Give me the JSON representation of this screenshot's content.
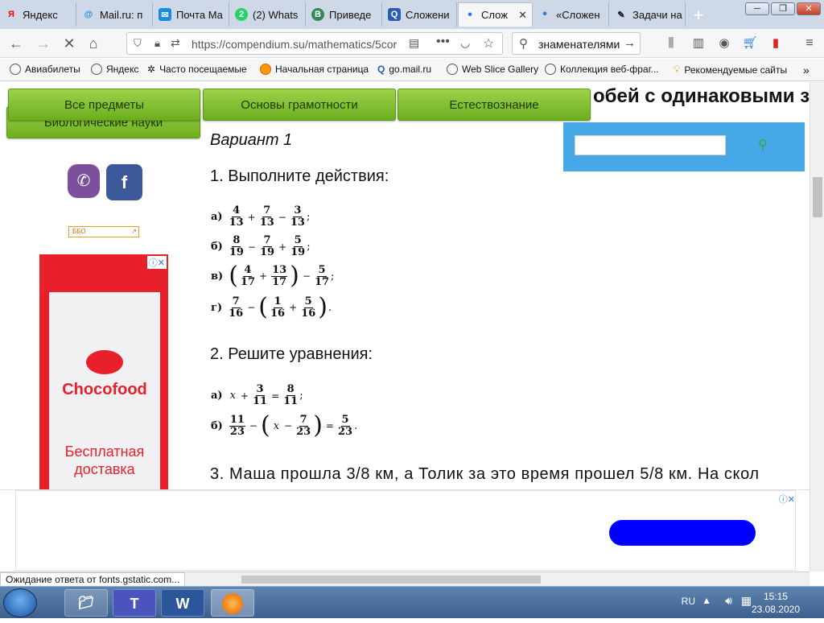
{
  "tabs": [
    {
      "label": "Яндекс",
      "icon": "Я",
      "color": "#ff0000"
    },
    {
      "label": "Mail.ru: п",
      "icon": "@",
      "color": "#168de2"
    },
    {
      "label": "Почта Ма",
      "icon": "✉",
      "color": "#168de2"
    },
    {
      "label": "(2) Whats",
      "icon": "2",
      "color": "#25d366"
    },
    {
      "label": "Приведе",
      "icon": "В",
      "color": "#2e8b57"
    },
    {
      "label": "Сложени",
      "icon": "Q",
      "color": "#2a5db0"
    },
    {
      "label": "Слож",
      "icon": "•",
      "color": "#2a7ae2"
    },
    {
      "label": "«Сложен",
      "icon": "•",
      "color": "#2a7ae2"
    },
    {
      "label": "Задачи на",
      "icon": "✎",
      "color": "#333333"
    }
  ],
  "nav": {
    "url": "https://compendium.su/mathematics/5cor",
    "search": "знаменателями"
  },
  "bookmarks": [
    "Авиабилеты",
    "Яндекс",
    "Часто посещаемые",
    "Начальная страница",
    "go.mail.ru",
    "Web Slice Gallery",
    "Коллекция веб-фраг...",
    "Рекомендуемые сайты"
  ],
  "page": {
    "menu": [
      "Все предметы",
      "Основы грамотности",
      "Естествознание",
      "Биологические науки"
    ],
    "heading": "обей с одинаковыми зн",
    "variant": "Вариант 1",
    "task1": "1. Выполните действия:",
    "task2": "2. Решите уравнения:",
    "task3": "3. Маша прошла 3/8 км, а Толик за это время прошел 5/8 км. На скол",
    "labels": {
      "a": "а)",
      "b": "б)",
      "v": "в)",
      "g": "г)"
    },
    "var_x": "x",
    "ops": {
      "plus": "+",
      "minus": "−",
      "eq": "=",
      "semi": ";",
      "dot": ".",
      "lparen": "(",
      "rparen": ")"
    }
  },
  "fractions": {
    "f4_13": {
      "n": "4",
      "d": "13"
    },
    "f7_13": {
      "n": "7",
      "d": "13"
    },
    "f3_13": {
      "n": "3",
      "d": "13"
    },
    "f8_19": {
      "n": "8",
      "d": "19"
    },
    "f7_19": {
      "n": "7",
      "d": "19"
    },
    "f5_19": {
      "n": "5",
      "d": "19"
    },
    "f4_17": {
      "n": "4",
      "d": "17"
    },
    "f13_17": {
      "n": "13",
      "d": "17"
    },
    "f5_17": {
      "n": "5",
      "d": "17"
    },
    "f7_16": {
      "n": "7",
      "d": "16"
    },
    "f1_16": {
      "n": "1",
      "d": "16"
    },
    "f5_16": {
      "n": "5",
      "d": "16"
    },
    "f3_11": {
      "n": "3",
      "d": "11"
    },
    "f8_11": {
      "n": "8",
      "d": "11"
    },
    "f11_23": {
      "n": "11",
      "d": "23"
    },
    "f7_23": {
      "n": "7",
      "d": "23"
    },
    "f5_23": {
      "n": "5",
      "d": "23"
    }
  },
  "sidebar": {
    "viber": "✆",
    "facebook": "f",
    "adtag": "ББО",
    "ad_brand": "Chocofood",
    "ad_text": "Бесплатная доставка"
  },
  "status": "Ожидание ответа от fonts.gstatic.com...",
  "taskbar": {
    "lang": "RU",
    "time": "15:15",
    "date": "23.08.2020"
  }
}
